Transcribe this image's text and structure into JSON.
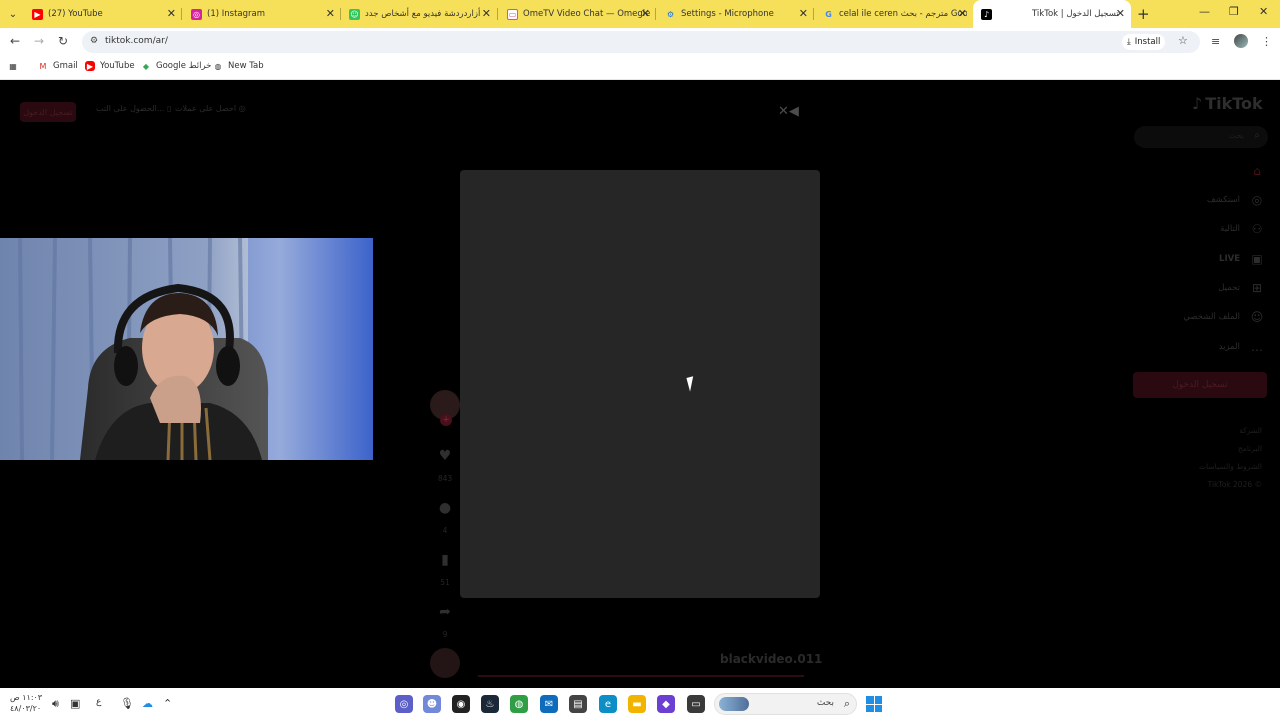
{
  "browser": {
    "tabs": [
      {
        "label": "(27) YouTube",
        "icon": "youtube-icon",
        "color": "#ff0000"
      },
      {
        "label": "(1) Instagram",
        "icon": "instagram-icon",
        "color": "#d6249f"
      },
      {
        "label": "أزاردردشة فيديو مع أشخاص جدد",
        "icon": "chat-icon",
        "color": "#30c75e"
      },
      {
        "label": "OmeTV Video Chat — Omegle",
        "icon": "ometv-icon",
        "color": "#e84e8a"
      },
      {
        "label": "Settings - Microphone",
        "icon": "gear-icon",
        "color": "#1a73e8"
      },
      {
        "label": "celal ile ceren مترجم - بحث Goo",
        "icon": "google-icon",
        "color": "#4285f4"
      },
      {
        "label": "TikTok | تسجيل الدخول",
        "icon": "tiktok-icon",
        "color": "#000000"
      }
    ],
    "active_tab_index": 6,
    "url": "tiktok.com/ar/",
    "install_label": "Install",
    "bookmarks": [
      {
        "label": "Gmail",
        "icon": "gmail-icon"
      },
      {
        "label": "YouTube",
        "icon": "youtube-icon"
      },
      {
        "label": "Google خرائط",
        "icon": "maps-icon"
      },
      {
        "label": "New Tab",
        "icon": "globe-icon"
      }
    ]
  },
  "tiktok": {
    "top_login": "تسجيل الدخول",
    "top_get_app": "الحصول على التب...",
    "top_get_coins": "احصل على عملات",
    "logo": "TikTok",
    "search_placeholder": "بحث",
    "nav": [
      {
        "label": "",
        "icon": "home-icon"
      },
      {
        "label": "استكشف",
        "icon": "compass-icon"
      },
      {
        "label": "التالية",
        "icon": "following-icon"
      },
      {
        "label": "LIVE",
        "icon": "live-icon"
      },
      {
        "label": "تحميل",
        "icon": "upload-icon"
      },
      {
        "label": "الملف الشخصي",
        "icon": "profile-icon"
      },
      {
        "label": "المزيد",
        "icon": "more-icon"
      }
    ],
    "sidebar_login": "تسجيل الدخول",
    "footer": [
      "الشركة",
      "البرنامج",
      "الشروط والسياسات",
      "TikTok 2026 ©"
    ],
    "actions": {
      "likes": "843",
      "comments": "4",
      "saves": "51",
      "shares": "9"
    },
    "author": "blackvideo.011"
  },
  "taskbar": {
    "time": "١١:٠٣ ص",
    "date": "٤٨/٠٣/٢٠",
    "lang": "ع",
    "search_text": "بحث"
  },
  "colors": {
    "tabstrip": "#f6e05a",
    "tiktok_accent": "#fe2c55",
    "page_bg": "#000000"
  }
}
